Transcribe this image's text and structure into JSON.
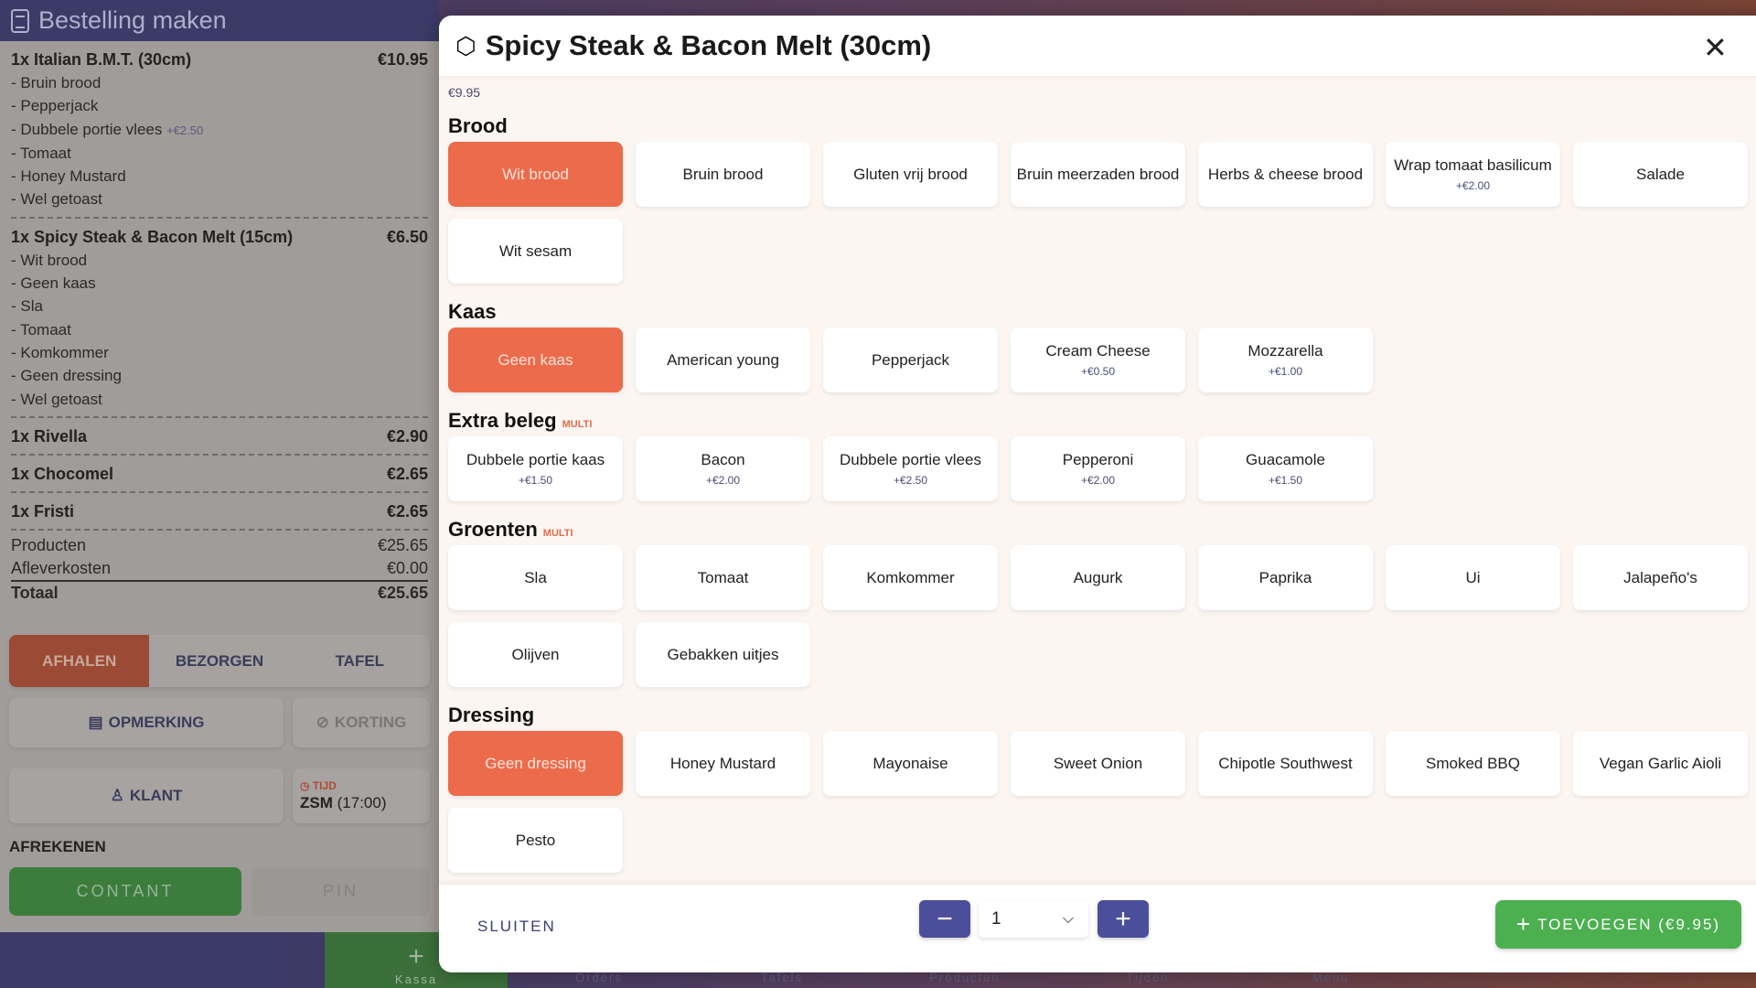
{
  "left": {
    "title": "Bestelling maken",
    "orders": [
      {
        "name": "1x Italian B.M.T. (30cm)",
        "price": "€10.95",
        "lines": [
          {
            "t": "- Bruin brood"
          },
          {
            "t": "- Pepperjack"
          },
          {
            "t": "- Dubbele portie vlees",
            "ex": "+€2.50"
          },
          {
            "t": "- Tomaat"
          },
          {
            "t": "- Honey Mustard"
          },
          {
            "t": "- Wel getoast"
          }
        ]
      },
      {
        "name": "1x Spicy Steak & Bacon Melt (15cm)",
        "price": "€6.50",
        "lines": [
          {
            "t": "- Wit brood"
          },
          {
            "t": "- Geen kaas"
          },
          {
            "t": "- Sla"
          },
          {
            "t": "- Tomaat"
          },
          {
            "t": "- Komkommer"
          },
          {
            "t": "- Geen dressing"
          },
          {
            "t": "- Wel getoast"
          }
        ]
      },
      {
        "name": "1x Rivella",
        "price": "€2.90",
        "lines": []
      },
      {
        "name": "1x Chocomel",
        "price": "€2.65",
        "lines": []
      },
      {
        "name": "1x Fristi",
        "price": "€2.65",
        "lines": []
      }
    ],
    "totals": {
      "products_label": "Producten",
      "products": "€25.65",
      "delivery_label": "Afleverkosten",
      "delivery": "€0.00",
      "total_label": "Totaal",
      "total": "€25.65"
    },
    "modes": [
      "AFHALEN",
      "BEZORGEN",
      "TAFEL"
    ],
    "remark": "OPMERKING",
    "discount": "KORTING",
    "customer": "KLANT",
    "time_label": "TIJD",
    "time_value": "ZSM",
    "time_extra": "(17:00)",
    "checkout": "AFREKENEN",
    "cash": "CONTANT",
    "pin": "PIN"
  },
  "nav": [
    "Kassa",
    "Orders",
    "Tafels",
    "Producten",
    "Tijden",
    "Menu"
  ],
  "modal": {
    "title": "Spicy Steak & Bacon Melt (30cm)",
    "price": "€9.95",
    "sections": [
      {
        "title": "Brood",
        "multi": "",
        "options": [
          {
            "l": "Wit brood",
            "sel": true
          },
          {
            "l": "Bruin brood"
          },
          {
            "l": "Gluten vrij brood"
          },
          {
            "l": "Bruin meerzaden brood"
          },
          {
            "l": "Herbs & cheese brood"
          },
          {
            "l": "Wrap tomaat basilicum",
            "ex": "+€2.00"
          },
          {
            "l": "Salade"
          },
          {
            "l": "Wit sesam"
          }
        ]
      },
      {
        "title": "Kaas",
        "multi": "",
        "options": [
          {
            "l": "Geen kaas",
            "sel": true
          },
          {
            "l": "American young"
          },
          {
            "l": "Pepperjack"
          },
          {
            "l": "Cream Cheese",
            "ex": "+€0.50"
          },
          {
            "l": "Mozzarella",
            "ex": "+€1.00"
          }
        ]
      },
      {
        "title": "Extra beleg",
        "multi": "MULTI",
        "options": [
          {
            "l": "Dubbele portie kaas",
            "ex": "+€1.50"
          },
          {
            "l": "Bacon",
            "ex": "+€2.00"
          },
          {
            "l": "Dubbele portie vlees",
            "ex": "+€2.50"
          },
          {
            "l": "Pepperoni",
            "ex": "+€2.00"
          },
          {
            "l": "Guacamole",
            "ex": "+€1.50"
          }
        ]
      },
      {
        "title": "Groenten",
        "multi": "MULTI",
        "options": [
          {
            "l": "Sla"
          },
          {
            "l": "Tomaat"
          },
          {
            "l": "Komkommer"
          },
          {
            "l": "Augurk"
          },
          {
            "l": "Paprika"
          },
          {
            "l": "Ui"
          },
          {
            "l": "Jalapeño's"
          },
          {
            "l": "Olijven"
          },
          {
            "l": "Gebakken uitjes"
          }
        ]
      },
      {
        "title": "Dressing",
        "multi": "",
        "options": [
          {
            "l": "Geen dressing",
            "sel": true
          },
          {
            "l": "Honey Mustard"
          },
          {
            "l": "Mayonaise"
          },
          {
            "l": "Sweet Onion"
          },
          {
            "l": "Chipotle Southwest"
          },
          {
            "l": "Smoked BBQ"
          },
          {
            "l": "Vegan Garlic Aioli"
          },
          {
            "l": "Pesto"
          }
        ]
      }
    ],
    "close_label": "SLUITEN",
    "quantity": "1",
    "add_label": "TOEVOEGEN (€9.95)"
  },
  "colors": {
    "accent": "#ec6b4b",
    "primary": "#4b4e9b",
    "success": "#4caf50"
  }
}
